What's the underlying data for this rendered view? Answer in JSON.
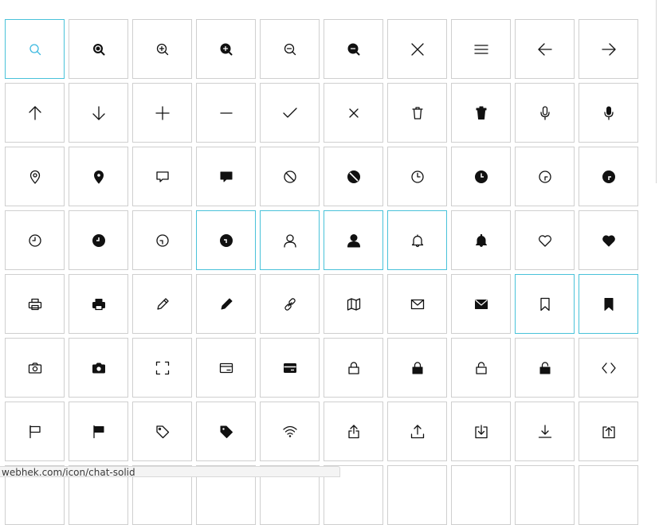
{
  "colors": {
    "highlight_border": "#49c2d9",
    "tile_border": "#cfcfcf",
    "active_icon": "#3cb9e0"
  },
  "status_url": "webhek.com/icon/chat-solid",
  "icons": [
    {
      "name": "search",
      "highlight": true,
      "active": true
    },
    {
      "name": "search-solid"
    },
    {
      "name": "zoom-in"
    },
    {
      "name": "zoom-in-solid"
    },
    {
      "name": "zoom-out"
    },
    {
      "name": "zoom-out-solid"
    },
    {
      "name": "close"
    },
    {
      "name": "menu"
    },
    {
      "name": "arrow-left"
    },
    {
      "name": "arrow-right"
    },
    {
      "name": "arrow-up"
    },
    {
      "name": "arrow-down"
    },
    {
      "name": "plus"
    },
    {
      "name": "minus"
    },
    {
      "name": "check"
    },
    {
      "name": "close-small"
    },
    {
      "name": "trash"
    },
    {
      "name": "trash-solid"
    },
    {
      "name": "microphone"
    },
    {
      "name": "microphone-solid"
    },
    {
      "name": "location"
    },
    {
      "name": "location-solid"
    },
    {
      "name": "chat"
    },
    {
      "name": "chat-solid"
    },
    {
      "name": "ban"
    },
    {
      "name": "ban-solid"
    },
    {
      "name": "clock"
    },
    {
      "name": "clock-solid"
    },
    {
      "name": "clock-alt"
    },
    {
      "name": "clock-alt-solid"
    },
    {
      "name": "clock-left"
    },
    {
      "name": "clock-left-solid"
    },
    {
      "name": "clock-down"
    },
    {
      "name": "clock-down-solid",
      "highlight": true
    },
    {
      "name": "user",
      "highlight": true
    },
    {
      "name": "user-solid",
      "highlight": true
    },
    {
      "name": "bell",
      "highlight": true
    },
    {
      "name": "bell-solid"
    },
    {
      "name": "heart"
    },
    {
      "name": "heart-solid"
    },
    {
      "name": "printer"
    },
    {
      "name": "printer-solid"
    },
    {
      "name": "pencil"
    },
    {
      "name": "pencil-solid"
    },
    {
      "name": "link"
    },
    {
      "name": "map"
    },
    {
      "name": "mail"
    },
    {
      "name": "mail-solid"
    },
    {
      "name": "bookmark",
      "highlight": true
    },
    {
      "name": "bookmark-solid",
      "highlight": true
    },
    {
      "name": "camera"
    },
    {
      "name": "camera-solid"
    },
    {
      "name": "fullscreen"
    },
    {
      "name": "credit-card"
    },
    {
      "name": "credit-card-solid"
    },
    {
      "name": "lock"
    },
    {
      "name": "lock-solid"
    },
    {
      "name": "unlock"
    },
    {
      "name": "unlock-solid"
    },
    {
      "name": "code"
    },
    {
      "name": "flag"
    },
    {
      "name": "flag-solid"
    },
    {
      "name": "tag"
    },
    {
      "name": "tag-solid"
    },
    {
      "name": "wifi"
    },
    {
      "name": "share"
    },
    {
      "name": "upload"
    },
    {
      "name": "download-box"
    },
    {
      "name": "download"
    },
    {
      "name": "upload-box"
    },
    {
      "name": "row-8-1"
    },
    {
      "name": "row-8-2"
    },
    {
      "name": "row-8-3"
    },
    {
      "name": "row-8-4"
    },
    {
      "name": "row-8-5"
    },
    {
      "name": "row-8-6"
    },
    {
      "name": "row-8-7"
    },
    {
      "name": "row-8-8"
    },
    {
      "name": "row-8-9"
    },
    {
      "name": "row-8-10"
    }
  ]
}
